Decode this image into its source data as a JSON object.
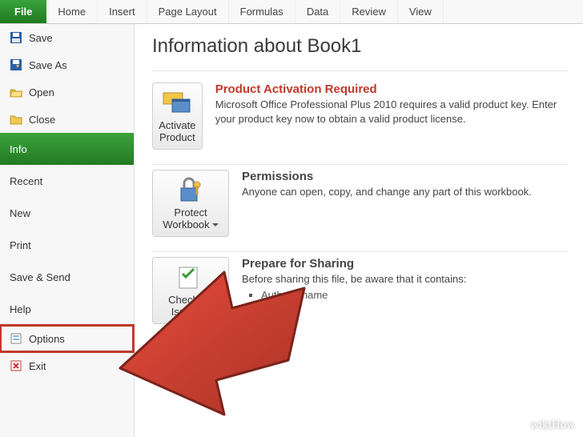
{
  "ribbon": {
    "tabs": [
      "File",
      "Home",
      "Insert",
      "Page Layout",
      "Formulas",
      "Data",
      "Review",
      "View"
    ]
  },
  "sidebar": {
    "items": [
      {
        "label": "Save",
        "icon": "save-icon"
      },
      {
        "label": "Save As",
        "icon": "save-as-icon"
      },
      {
        "label": "Open",
        "icon": "open-icon"
      },
      {
        "label": "Close",
        "icon": "close-folder-icon"
      },
      {
        "label": "Info",
        "icon": null
      },
      {
        "label": "Recent",
        "icon": null
      },
      {
        "label": "New",
        "icon": null
      },
      {
        "label": "Print",
        "icon": null
      },
      {
        "label": "Save & Send",
        "icon": null
      },
      {
        "label": "Help",
        "icon": null
      },
      {
        "label": "Options",
        "icon": "options-icon"
      },
      {
        "label": "Exit",
        "icon": "exit-icon"
      }
    ]
  },
  "main": {
    "title": "Information about Book1",
    "sections": {
      "activation": {
        "button_label": "Activate Product",
        "heading": "Product Activation Required",
        "body": "Microsoft Office Professional Plus 2010 requires a valid product key. Enter your product key now to obtain a valid product license."
      },
      "permissions": {
        "button_label": "Protect Workbook",
        "heading": "Permissions",
        "body": "Anyone can open, copy, and change any part of this workbook."
      },
      "sharing": {
        "button_label": "Check for Issues",
        "heading": "Prepare for Sharing",
        "body": "Before sharing this file, be aware that it contains:",
        "items": [
          "Author's name"
        ]
      }
    }
  },
  "watermark": "wikiHow"
}
